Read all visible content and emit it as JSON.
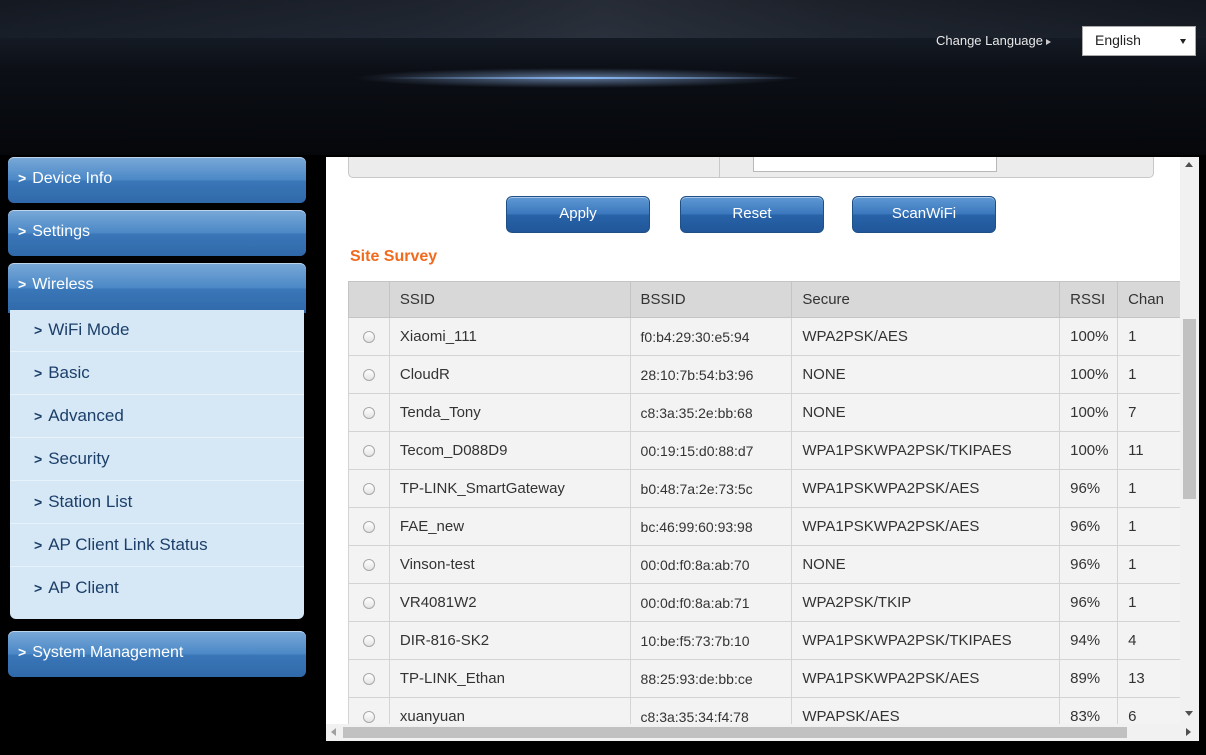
{
  "header": {
    "change_language_label": "Change Language",
    "language_selected": "English"
  },
  "sidebar": {
    "items": [
      {
        "label": "Device Info"
      },
      {
        "label": "Settings"
      },
      {
        "label": "Wireless"
      },
      {
        "label": "System Management"
      }
    ],
    "wireless_sub": [
      {
        "label": "WiFi Mode"
      },
      {
        "label": "Basic"
      },
      {
        "label": "Advanced"
      },
      {
        "label": "Security"
      },
      {
        "label": "Station List"
      },
      {
        "label": "AP Client Link Status"
      },
      {
        "label": "AP Client"
      }
    ]
  },
  "buttons": {
    "apply": "Apply",
    "reset": "Reset",
    "scan": "ScanWiFi"
  },
  "survey": {
    "title": "Site Survey",
    "columns": [
      "SSID",
      "BSSID",
      "Secure",
      "RSSI",
      "Chan"
    ],
    "rows": [
      {
        "ssid": "Xiaomi_111",
        "bssid": "f0:b4:29:30:e5:94",
        "secure": "WPA2PSK/AES",
        "rssi": "100%",
        "chan": "1"
      },
      {
        "ssid": "CloudR",
        "bssid": "28:10:7b:54:b3:96",
        "secure": "NONE",
        "rssi": "100%",
        "chan": "1"
      },
      {
        "ssid": "Tenda_Tony",
        "bssid": "c8:3a:35:2e:bb:68",
        "secure": "NONE",
        "rssi": "100%",
        "chan": "7"
      },
      {
        "ssid": "Tecom_D088D9",
        "bssid": "00:19:15:d0:88:d7",
        "secure": "WPA1PSKWPA2PSK/TKIPAES",
        "rssi": "100%",
        "chan": "11"
      },
      {
        "ssid": "TP-LINK_SmartGateway",
        "bssid": "b0:48:7a:2e:73:5c",
        "secure": "WPA1PSKWPA2PSK/AES",
        "rssi": "96%",
        "chan": "1"
      },
      {
        "ssid": "FAE_new",
        "bssid": "bc:46:99:60:93:98",
        "secure": "WPA1PSKWPA2PSK/AES",
        "rssi": "96%",
        "chan": "1"
      },
      {
        "ssid": "Vinson-test",
        "bssid": "00:0d:f0:8a:ab:70",
        "secure": "NONE",
        "rssi": "96%",
        "chan": "1"
      },
      {
        "ssid": "VR4081W2",
        "bssid": "00:0d:f0:8a:ab:71",
        "secure": "WPA2PSK/TKIP",
        "rssi": "96%",
        "chan": "1"
      },
      {
        "ssid": "DIR-816-SK2",
        "bssid": "10:be:f5:73:7b:10",
        "secure": "WPA1PSKWPA2PSK/TKIPAES",
        "rssi": "94%",
        "chan": "4"
      },
      {
        "ssid": "TP-LINK_Ethan",
        "bssid": "88:25:93:de:bb:ce",
        "secure": "WPA1PSKWPA2PSK/AES",
        "rssi": "89%",
        "chan": "13"
      },
      {
        "ssid": "xuanyuan",
        "bssid": "c8:3a:35:34:f4:78",
        "secure": "WPAPSK/AES",
        "rssi": "83%",
        "chan": "6"
      }
    ]
  },
  "colors": {
    "menu_blue": "#3a77b8",
    "submenu_bg": "#d6e8f6",
    "title_orange": "#f26b1d"
  }
}
